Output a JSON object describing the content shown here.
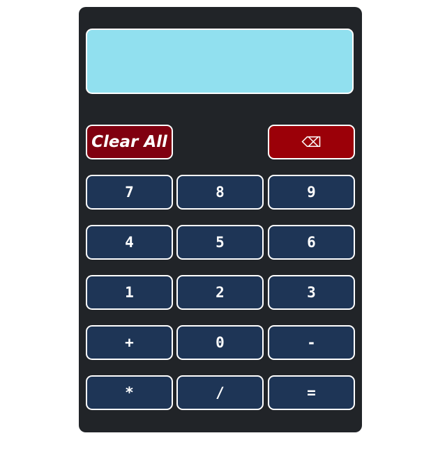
{
  "display": {
    "value": ""
  },
  "controls": {
    "clear_all_label": "Clear All",
    "backspace_label": "⌫"
  },
  "keys": {
    "seven": "7",
    "eight": "8",
    "nine": "9",
    "four": "4",
    "five": "5",
    "six": "6",
    "one": "1",
    "two": "2",
    "three": "3",
    "plus": "+",
    "zero": "0",
    "minus": "-",
    "multiply": "*",
    "divide": "/",
    "equals": "="
  },
  "colors": {
    "panel": "#212428",
    "display": "#91e0ef",
    "key": "#1e3556",
    "clear": "#800010",
    "backspace": "#9b0008",
    "border": "#ffffff"
  }
}
